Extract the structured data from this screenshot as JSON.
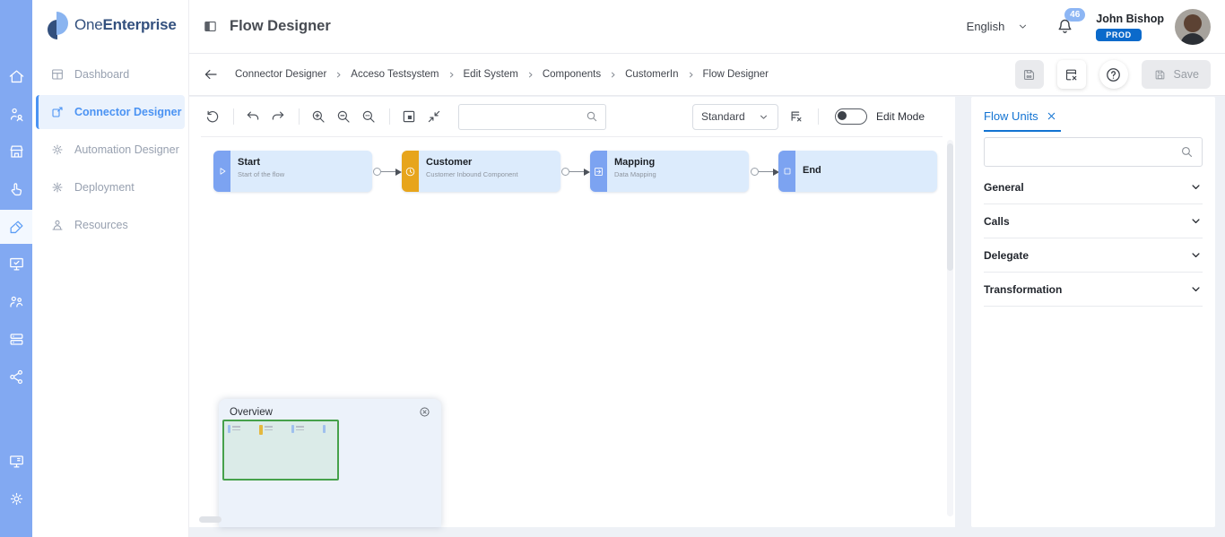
{
  "brand": {
    "name_regular": "One",
    "name_bold": "Enterprise"
  },
  "header": {
    "page_title": "Flow Designer",
    "language": "English",
    "notification_count": "46",
    "user_name": "John Bishop",
    "environment_badge": "PROD"
  },
  "sidebar": {
    "items": [
      {
        "label": "Dashboard"
      },
      {
        "label": "Connector Designer"
      },
      {
        "label": "Automation Designer"
      },
      {
        "label": "Deployment"
      },
      {
        "label": "Resources"
      }
    ]
  },
  "breadcrumb": {
    "items": [
      "Connector Designer",
      "Acceso Testsystem",
      "Edit System",
      "Components",
      "CustomerIn",
      "Flow Designer"
    ]
  },
  "actions": {
    "save_label": "Save"
  },
  "canvas": {
    "toolbar": {
      "layout_preset": "Standard",
      "edit_mode_label": "Edit Mode",
      "search_value": ""
    },
    "nodes": [
      {
        "title": "Start",
        "subtitle": "Start of the flow",
        "accent": "#7ca3f1",
        "icon": "play-icon"
      },
      {
        "title": "Customer",
        "subtitle": "Customer Inbound Component",
        "accent": "#e7a51c",
        "icon": "clock-icon"
      },
      {
        "title": "Mapping",
        "subtitle": "Data Mapping",
        "accent": "#7ca3f1",
        "icon": "mapping-icon"
      },
      {
        "title": "End",
        "subtitle": "",
        "accent": "#7ca3f1",
        "icon": "stop-icon"
      }
    ],
    "overview": {
      "title": "Overview"
    }
  },
  "flow_units": {
    "tab_label": "Flow Units",
    "search_value": "",
    "sections": [
      {
        "label": "General"
      },
      {
        "label": "Calls"
      },
      {
        "label": "Delegate"
      },
      {
        "label": "Transformation"
      }
    ]
  },
  "colors": {
    "rail_blue": "#82a9f2",
    "accent_blue": "#4b93f3",
    "node_body": "#dcebfc",
    "node_strip_blue": "#7ca3f1",
    "node_strip_orange": "#e7a51c",
    "prod_badge": "#0b6acb",
    "notification_badge": "#8db6f4",
    "tab_blue": "#1273d2",
    "minimap_green": "#46a14b"
  }
}
